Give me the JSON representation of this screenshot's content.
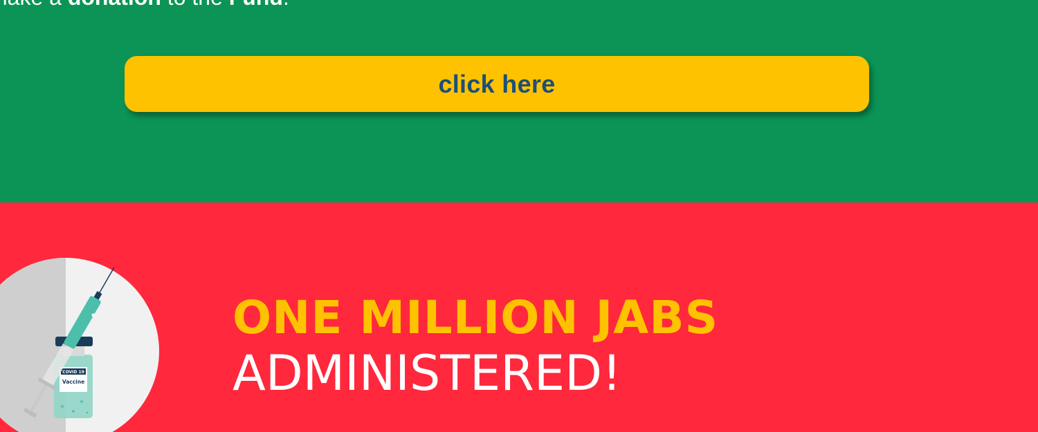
{
  "donation": {
    "prefix": "make a ",
    "donation_word": "donation",
    "middle": " to the ",
    "fund_word": "Fund",
    "suffix": "."
  },
  "cta": {
    "label": "click here"
  },
  "headline": {
    "line1": "ONE MILLION JABS",
    "line2": "ADMINISTERED!"
  },
  "illustration": {
    "vial_label_top": "COVID 19",
    "vial_label_bottom": "Vaccine"
  },
  "colors": {
    "green_bg": "#0b9455",
    "red_bg": "#ff283c",
    "accent_yellow": "#ffc200",
    "button_text": "#1d4f78"
  }
}
